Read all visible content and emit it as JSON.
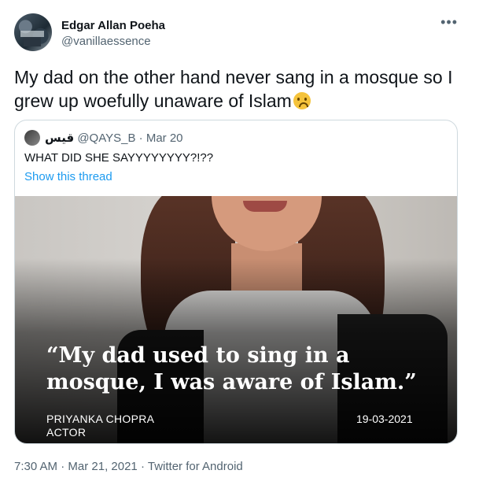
{
  "tweet": {
    "author_name": "Edgar Allan Poeha",
    "author_handle": "@vanillaessence",
    "more_icon": "•••",
    "text": "My dad on the other hand never sang in a mosque so I grew up woefully unaware of Islam",
    "emoji": "worried-face"
  },
  "quoted_tweet": {
    "author_name": "قيس",
    "author_handle": "@QAYS_B",
    "separator": "·",
    "date": "Mar 20",
    "text": "WHAT DID SHE SAYYYYYYYY?!??",
    "show_thread": "Show this thread",
    "media": {
      "quote": "“My dad used to sing in a mosque, I was aware of Islam.”",
      "person_name": "PRIYANKA CHOPRA",
      "person_role": "ACTOR",
      "date": "19-03-2021"
    }
  },
  "meta": {
    "time": "7:30 AM",
    "separator": "·",
    "date": "Mar 21, 2021",
    "source": "Twitter for Android"
  }
}
